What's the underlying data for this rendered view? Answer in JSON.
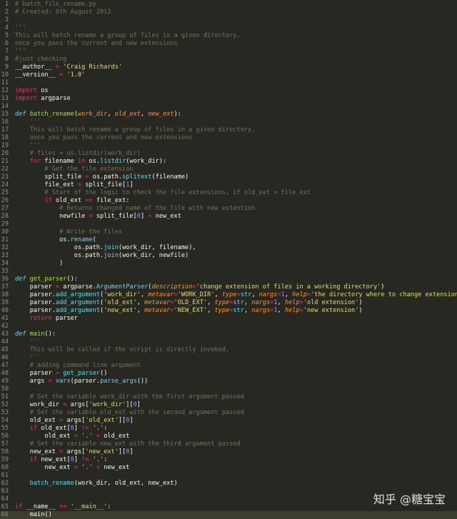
{
  "editor": {
    "current_line": 66,
    "lines": [
      [
        [
          "c",
          "# batch_file_rename.py"
        ]
      ],
      [
        [
          "c",
          "# Created: 6th August 2012"
        ]
      ],
      [],
      [
        [
          "c",
          "'''"
        ]
      ],
      [
        [
          "c",
          "This will batch rename a group of files in a given directory,"
        ]
      ],
      [
        [
          "c",
          "once you pass the current and new extensions"
        ]
      ],
      [
        [
          "c",
          "'''"
        ]
      ],
      [
        [
          "c",
          "#just checking"
        ]
      ],
      [
        [
          "t",
          "__author__ "
        ],
        [
          "o",
          "="
        ],
        [
          "t",
          " "
        ],
        [
          "s",
          "'Craig Richards'"
        ]
      ],
      [
        [
          "t",
          "__version__ "
        ],
        [
          "o",
          "="
        ],
        [
          "t",
          " "
        ],
        [
          "s",
          "'1.0'"
        ]
      ],
      [],
      [
        [
          "k",
          "import"
        ],
        [
          "t",
          " os"
        ]
      ],
      [
        [
          "k",
          "import"
        ],
        [
          "t",
          " argparse"
        ]
      ],
      [],
      [
        [
          "d",
          "def"
        ],
        [
          "t",
          " "
        ],
        [
          "f",
          "batch_rename"
        ],
        [
          "t",
          "("
        ],
        [
          "p",
          "work_dir"
        ],
        [
          "t",
          ", "
        ],
        [
          "p",
          "old_ext"
        ],
        [
          "t",
          ", "
        ],
        [
          "p",
          "new_ext"
        ],
        [
          "t",
          "):"
        ]
      ],
      [
        [
          "c",
          "    '''"
        ]
      ],
      [
        [
          "c",
          "    This will batch rename a group of files in a given directory,"
        ]
      ],
      [
        [
          "c",
          "    once you pass the current and new extensions"
        ]
      ],
      [
        [
          "c",
          "    '''"
        ]
      ],
      [
        [
          "c",
          "    # files = os.listdir(work_dir)"
        ]
      ],
      [
        [
          "t",
          "    "
        ],
        [
          "k",
          "for"
        ],
        [
          "t",
          " filename "
        ],
        [
          "k",
          "in"
        ],
        [
          "t",
          " os."
        ],
        [
          "b",
          "listdir"
        ],
        [
          "t",
          "(work_dir):"
        ]
      ],
      [
        [
          "c",
          "        # Get the file extension"
        ]
      ],
      [
        [
          "t",
          "        split_file "
        ],
        [
          "o",
          "="
        ],
        [
          "t",
          " os.path."
        ],
        [
          "b",
          "splitext"
        ],
        [
          "t",
          "(filename)"
        ]
      ],
      [
        [
          "t",
          "        file_ext "
        ],
        [
          "o",
          "="
        ],
        [
          "t",
          " split_file["
        ],
        [
          "n",
          "1"
        ],
        [
          "t",
          "]"
        ]
      ],
      [
        [
          "c",
          "        # Start of the logic to check the file extensions, if old_ext = file_ext"
        ]
      ],
      [
        [
          "t",
          "        "
        ],
        [
          "k",
          "if"
        ],
        [
          "t",
          " old_ext "
        ],
        [
          "o",
          "=="
        ],
        [
          "t",
          " file_ext:"
        ]
      ],
      [
        [
          "c",
          "            # Returns changed name of the file with new extention"
        ]
      ],
      [
        [
          "t",
          "            newfile "
        ],
        [
          "o",
          "="
        ],
        [
          "t",
          " split_file["
        ],
        [
          "n",
          "0"
        ],
        [
          "t",
          "] "
        ],
        [
          "o",
          "+"
        ],
        [
          "t",
          " new_ext"
        ]
      ],
      [],
      [
        [
          "c",
          "            # Write the files"
        ]
      ],
      [
        [
          "t",
          "            os."
        ],
        [
          "b",
          "rename"
        ],
        [
          "t",
          "("
        ]
      ],
      [
        [
          "t",
          "                os.path."
        ],
        [
          "b",
          "join"
        ],
        [
          "t",
          "(work_dir, filename),"
        ]
      ],
      [
        [
          "t",
          "                os.path."
        ],
        [
          "b",
          "join"
        ],
        [
          "t",
          "(work_dir, newfile)"
        ]
      ],
      [
        [
          "t",
          "            )"
        ]
      ],
      [],
      [
        [
          "d",
          "def"
        ],
        [
          "t",
          " "
        ],
        [
          "f",
          "get_parser"
        ],
        [
          "t",
          "():"
        ]
      ],
      [
        [
          "t",
          "    parser "
        ],
        [
          "o",
          "="
        ],
        [
          "t",
          " argparse."
        ],
        [
          "b",
          "ArgumentParser"
        ],
        [
          "t",
          "("
        ],
        [
          "p",
          "description"
        ],
        [
          "o",
          "="
        ],
        [
          "s",
          "'change extension of files in a working directory'"
        ],
        [
          "t",
          ")"
        ]
      ],
      [
        [
          "t",
          "    parser."
        ],
        [
          "b",
          "add_argument"
        ],
        [
          "t",
          "("
        ],
        [
          "s",
          "'work_dir'"
        ],
        [
          "t",
          ", "
        ],
        [
          "p",
          "metavar"
        ],
        [
          "o",
          "="
        ],
        [
          "s",
          "'WORK_DIR'"
        ],
        [
          "t",
          ", "
        ],
        [
          "p",
          "type"
        ],
        [
          "o",
          "="
        ],
        [
          "b",
          "str"
        ],
        [
          "t",
          ", "
        ],
        [
          "p",
          "nargs"
        ],
        [
          "o",
          "="
        ],
        [
          "n",
          "1"
        ],
        [
          "t",
          ", "
        ],
        [
          "p",
          "help"
        ],
        [
          "o",
          "="
        ],
        [
          "s",
          "'the directory where to change extension'"
        ],
        [
          "t",
          ")"
        ]
      ],
      [
        [
          "t",
          "    parser."
        ],
        [
          "b",
          "add_argument"
        ],
        [
          "t",
          "("
        ],
        [
          "s",
          "'old_ext'"
        ],
        [
          "t",
          ", "
        ],
        [
          "p",
          "metavar"
        ],
        [
          "o",
          "="
        ],
        [
          "s",
          "'OLD_EXT'"
        ],
        [
          "t",
          ", "
        ],
        [
          "p",
          "type"
        ],
        [
          "o",
          "="
        ],
        [
          "b",
          "str"
        ],
        [
          "t",
          ", "
        ],
        [
          "p",
          "nargs"
        ],
        [
          "o",
          "="
        ],
        [
          "n",
          "1"
        ],
        [
          "t",
          ", "
        ],
        [
          "p",
          "help"
        ],
        [
          "o",
          "="
        ],
        [
          "s",
          "'old extension'"
        ],
        [
          "t",
          ")"
        ]
      ],
      [
        [
          "t",
          "    parser."
        ],
        [
          "b",
          "add_argument"
        ],
        [
          "t",
          "("
        ],
        [
          "s",
          "'new_ext'"
        ],
        [
          "t",
          ", "
        ],
        [
          "p",
          "metavar"
        ],
        [
          "o",
          "="
        ],
        [
          "s",
          "'NEW_EXT'"
        ],
        [
          "t",
          ", "
        ],
        [
          "p",
          "type"
        ],
        [
          "o",
          "="
        ],
        [
          "b",
          "str"
        ],
        [
          "t",
          ", "
        ],
        [
          "p",
          "nargs"
        ],
        [
          "o",
          "="
        ],
        [
          "n",
          "1"
        ],
        [
          "t",
          ", "
        ],
        [
          "p",
          "help"
        ],
        [
          "o",
          "="
        ],
        [
          "s",
          "'new extension'"
        ],
        [
          "t",
          ")"
        ]
      ],
      [
        [
          "t",
          "    "
        ],
        [
          "k",
          "return"
        ],
        [
          "t",
          " parser"
        ]
      ],
      [],
      [
        [
          "d",
          "def"
        ],
        [
          "t",
          " "
        ],
        [
          "f",
          "main"
        ],
        [
          "t",
          "():"
        ]
      ],
      [
        [
          "c",
          "    '''"
        ]
      ],
      [
        [
          "c",
          "    This will be called if the script is directly invoked."
        ]
      ],
      [
        [
          "c",
          "    '''"
        ]
      ],
      [
        [
          "c",
          "    # adding command line argument"
        ]
      ],
      [
        [
          "t",
          "    parser "
        ],
        [
          "o",
          "="
        ],
        [
          "t",
          " "
        ],
        [
          "b",
          "get_parser"
        ],
        [
          "t",
          "()"
        ]
      ],
      [
        [
          "t",
          "    args "
        ],
        [
          "o",
          "="
        ],
        [
          "t",
          " "
        ],
        [
          "b",
          "vars"
        ],
        [
          "t",
          "(parser."
        ],
        [
          "b",
          "parse_args"
        ],
        [
          "t",
          "())"
        ]
      ],
      [],
      [
        [
          "c",
          "    # Set the variable work_dir with the first argument passed"
        ]
      ],
      [
        [
          "t",
          "    work_dir "
        ],
        [
          "o",
          "="
        ],
        [
          "t",
          " args["
        ],
        [
          "s",
          "'work_dir'"
        ],
        [
          "t",
          "]["
        ],
        [
          "n",
          "0"
        ],
        [
          "t",
          "]"
        ]
      ],
      [
        [
          "c",
          "    # Set the variable old_ext with the second argument passed"
        ]
      ],
      [
        [
          "t",
          "    old_ext "
        ],
        [
          "o",
          "="
        ],
        [
          "t",
          " args["
        ],
        [
          "s",
          "'old_ext'"
        ],
        [
          "t",
          "]["
        ],
        [
          "n",
          "0"
        ],
        [
          "t",
          "]"
        ]
      ],
      [
        [
          "t",
          "    "
        ],
        [
          "k",
          "if"
        ],
        [
          "t",
          " old_ext["
        ],
        [
          "n",
          "0"
        ],
        [
          "t",
          "] "
        ],
        [
          "o",
          "!="
        ],
        [
          "t",
          " "
        ],
        [
          "s",
          "'.'"
        ],
        [
          "t",
          ":"
        ]
      ],
      [
        [
          "t",
          "        old_ext "
        ],
        [
          "o",
          "="
        ],
        [
          "t",
          " "
        ],
        [
          "s",
          "'.'"
        ],
        [
          "t",
          " "
        ],
        [
          "o",
          "+"
        ],
        [
          "t",
          " old_ext"
        ]
      ],
      [
        [
          "c",
          "    # Set the variable new_ext with the third argument passed"
        ]
      ],
      [
        [
          "t",
          "    new_ext "
        ],
        [
          "o",
          "="
        ],
        [
          "t",
          " args["
        ],
        [
          "s",
          "'new_ext'"
        ],
        [
          "t",
          "]["
        ],
        [
          "n",
          "0"
        ],
        [
          "t",
          "]"
        ]
      ],
      [
        [
          "t",
          "    "
        ],
        [
          "k",
          "if"
        ],
        [
          "t",
          " new_ext["
        ],
        [
          "n",
          "0"
        ],
        [
          "t",
          "] "
        ],
        [
          "o",
          "!="
        ],
        [
          "t",
          " "
        ],
        [
          "s",
          "'.'"
        ],
        [
          "t",
          ":"
        ]
      ],
      [
        [
          "t",
          "        new_ext "
        ],
        [
          "o",
          "="
        ],
        [
          "t",
          " "
        ],
        [
          "s",
          "'.'"
        ],
        [
          "t",
          " "
        ],
        [
          "o",
          "+"
        ],
        [
          "t",
          " new_ext"
        ]
      ],
      [],
      [
        [
          "t",
          "    "
        ],
        [
          "b",
          "batch_rename"
        ],
        [
          "t",
          "(work_dir, old_ext, new_ext)"
        ]
      ],
      [],
      [],
      [
        [
          "k",
          "if"
        ],
        [
          "t",
          " __name__ "
        ],
        [
          "o",
          "=="
        ],
        [
          "t",
          " "
        ],
        [
          "s",
          "'__main__'"
        ],
        [
          "t",
          ":"
        ]
      ],
      [
        [
          "t",
          "    main()"
        ]
      ]
    ]
  },
  "watermark": {
    "text": "知乎 @糖宝宝"
  },
  "colors": {
    "background": "#272822",
    "current_line": "#3e3d32",
    "comment": "#75715e",
    "keyword": "#f92672",
    "function": "#a6e22e",
    "string": "#e6db74",
    "number": "#ae81ff",
    "builtin": "#66d9ef",
    "param": "#fd971f"
  }
}
